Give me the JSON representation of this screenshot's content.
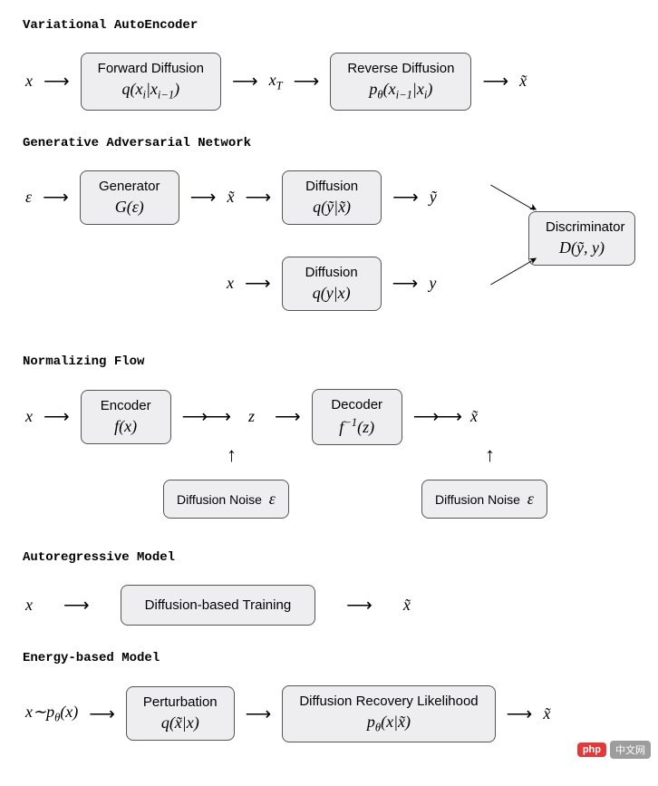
{
  "vae": {
    "title": "Variational AutoEncoder",
    "in": "x",
    "box1_title": "Forward Diffusion",
    "box1_formula": "q(xᵢ|xᵢ₋₁)",
    "mid": "x_T",
    "box2_title": "Reverse Diffusion",
    "box2_formula": "p_θ(xᵢ₋₁|xᵢ)",
    "out": "x̃"
  },
  "gan": {
    "title": "Generative Adversarial Network",
    "in": "ε",
    "gen_title": "Generator",
    "gen_formula": "G(ε)",
    "xgen": "x̃",
    "diff1_title": "Diffusion",
    "diff1_formula": "q(ỹ|x̃)",
    "ygen": "ỹ",
    "xreal": "x",
    "diff2_title": "Diffusion",
    "diff2_formula": "q(y|x)",
    "yreal": "y",
    "disc_title": "Discriminator",
    "disc_formula": "D(ỹ, y)"
  },
  "flow": {
    "title": "Normalizing Flow",
    "in": "x",
    "enc_title": "Encoder",
    "enc_formula": "f(x)",
    "mid": "z",
    "dec_title": "Decoder",
    "dec_formula": "f⁻¹(z)",
    "out": "x̃",
    "noise1": "Diffusion Noise  ε",
    "noise2": "Diffusion Noise  ε"
  },
  "ar": {
    "title": "Autoregressive Model",
    "in": "x",
    "box": "Diffusion-based Training",
    "out": "x̃"
  },
  "ebm": {
    "title": "Energy-based Model",
    "in": "x∼p_θ(x)",
    "pert_title": "Perturbation",
    "pert_formula": "q(x̃|x)",
    "rec_title": "Diffusion Recovery Likelihood",
    "rec_formula": "p_θ(x|x̃)",
    "out": "x̃"
  },
  "watermark": {
    "badge": "php",
    "text": "中文网"
  }
}
